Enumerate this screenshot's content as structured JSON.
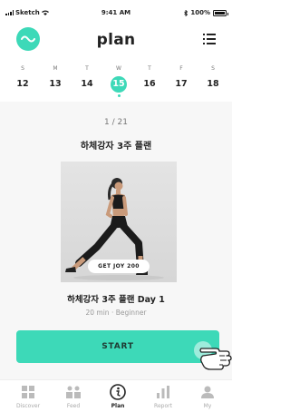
{
  "status_bar": {
    "carrier": "Sketch",
    "time": "9:41 AM",
    "battery": "100%"
  },
  "header": {
    "title": "plan"
  },
  "week": [
    {
      "dow": "S",
      "date": "12"
    },
    {
      "dow": "M",
      "date": "13"
    },
    {
      "dow": "T",
      "date": "14"
    },
    {
      "dow": "W",
      "date": "15",
      "selected": true
    },
    {
      "dow": "T",
      "date": "16"
    },
    {
      "dow": "F",
      "date": "17"
    },
    {
      "dow": "S",
      "date": "18"
    }
  ],
  "plan": {
    "counter": "1 / 21",
    "title": "하체강자 3주 플랜",
    "photo_label": "GET JOY 200",
    "day_title": "하체강자 3주 플랜 Day 1",
    "meta": "20 min · Beginner",
    "start_label": "START"
  },
  "tabs": [
    {
      "label": "Discover",
      "icon": "grid-icon"
    },
    {
      "label": "Feed",
      "icon": "feed-icon"
    },
    {
      "label": "Plan",
      "icon": "plan-icon",
      "active": true
    },
    {
      "label": "Report",
      "icon": "report-icon"
    },
    {
      "label": "My",
      "icon": "profile-icon"
    }
  ],
  "colors": {
    "accent": "#3dd9b8"
  }
}
